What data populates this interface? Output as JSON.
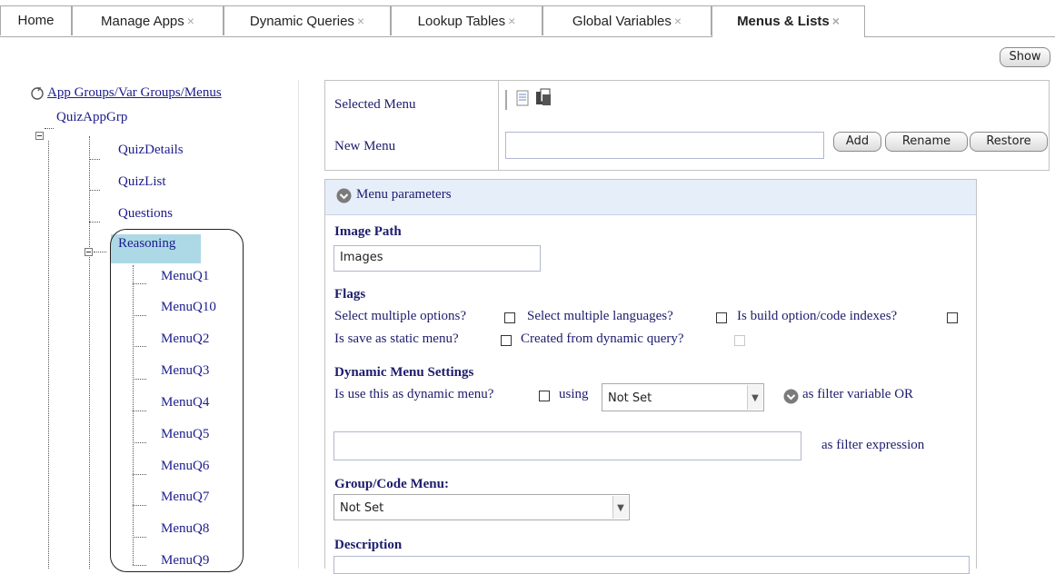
{
  "tabs": [
    {
      "label": "Home",
      "closable": false
    },
    {
      "label": "Manage Apps",
      "closable": true
    },
    {
      "label": "Dynamic Queries",
      "closable": true
    },
    {
      "label": "Lookup Tables",
      "closable": true
    },
    {
      "label": "Global Variables",
      "closable": true
    },
    {
      "label": "Menus & Lists",
      "closable": true,
      "active": true
    }
  ],
  "close_glyph": "×",
  "show_button": "Show",
  "tree": {
    "root": "App Groups/Var Groups/Menus",
    "group": "QuizAppGrp",
    "items": [
      "QuizDetails",
      "QuizList",
      "Questions"
    ],
    "selected": "Reasoning",
    "sub_items": [
      "MenuQ1",
      "MenuQ10",
      "MenuQ2",
      "MenuQ3",
      "MenuQ4",
      "MenuQ5",
      "MenuQ6",
      "MenuQ7",
      "MenuQ8",
      "MenuQ9"
    ]
  },
  "menu_box": {
    "selected_menu_label": "Selected Menu",
    "new_menu_label": "New Menu",
    "new_menu_value": "",
    "add": "Add",
    "rename": "Rename",
    "restore": "Restore"
  },
  "params": {
    "header": "Menu parameters",
    "image_path_label": "Image Path",
    "image_path_value": "Images",
    "flags_label": "Flags",
    "flag_select_multiple": "Select multiple options?",
    "flag_multi_lang": "Select multiple languages?",
    "flag_build_index": "Is build option/code indexes?",
    "flag_static": "Is save as static menu?",
    "flag_dynamic_query": "Created from dynamic query?",
    "dyn_label": "Dynamic Menu Settings",
    "dyn_use": "Is use this as dynamic menu?",
    "dyn_using": "using",
    "dyn_select": "Not Set",
    "dyn_filter_var": "as filter variable OR",
    "dyn_filter_expr_value": "",
    "dyn_filter_expr": "as filter expression",
    "group_code_label": "Group/Code Menu:",
    "group_code_select": "Not Set",
    "description_label": "Description"
  },
  "colors": {
    "selected_node": "#add8e6",
    "tree_text": "#1c1c8c",
    "panel_header": "#e6eefa"
  }
}
